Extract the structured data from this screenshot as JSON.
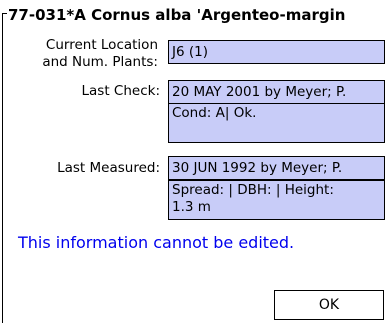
{
  "dialog": {
    "title": "77-031*A Cornus alba 'Argenteo-margin"
  },
  "fields": {
    "location_label_line1": "Current Location",
    "location_label_line2": "and Num. Plants:",
    "location_value": "J6 (1)",
    "last_check_label": "Last Check:",
    "last_check_value": "20 MAY 2001 by Meyer; P.",
    "condition_value": "Cond: A| Ok.",
    "last_measured_label": "Last Measured:",
    "last_measured_value": "30 JUN 1992 by Meyer; P.",
    "measurements_line1": "Spread:  | DBH:  | Height:",
    "measurements_line2": "1.3 m"
  },
  "notice": "This information cannot be edited.",
  "buttons": {
    "ok_label": "OK"
  },
  "colors": {
    "field_bg": "#c8ccf8",
    "notice_text": "#0000ee"
  }
}
